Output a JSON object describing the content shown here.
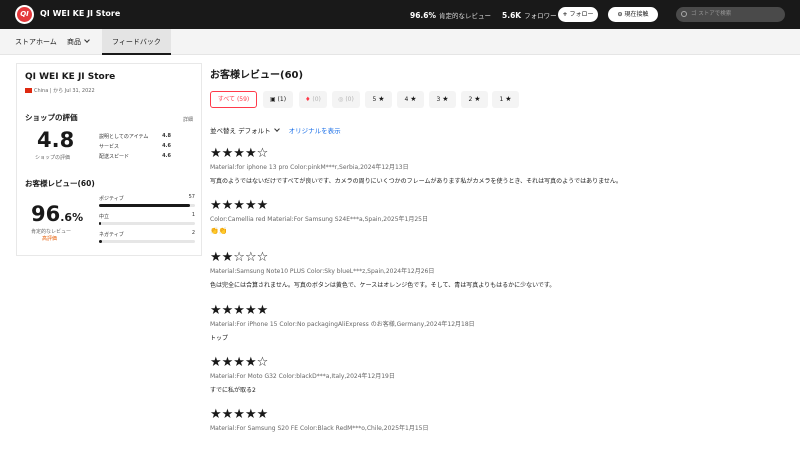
{
  "header": {
    "logo_text": "QI",
    "store_name": "QI WEI KE JI Store",
    "positive_rate": "96.6%",
    "positive_label": "肯定的なレビュー",
    "followers": "5.6K",
    "followers_label": "フォロワー",
    "follow_button": "フォロー",
    "follow_icon": "plus-icon",
    "message_button": "現在接触",
    "search_placeholder": "ゴ ストアで検索"
  },
  "nav": {
    "home": "ストアホーム",
    "products": "商品",
    "feedback": "フィードバック"
  },
  "shop": {
    "name": "QI WEI KE JI Store",
    "origin": "China | から Jul 31, 2022",
    "rating_section": "ショップの評価",
    "detail_link": "詳細",
    "score": "4.8",
    "score_label": "ショップの評価",
    "ratings": [
      {
        "label": "説明としてのアイテム",
        "value": "4.8"
      },
      {
        "label": "サービス",
        "value": "4.6"
      },
      {
        "label": "配送スピード",
        "value": "4.6"
      }
    ],
    "reviews_section": "お客様レビュー(60)",
    "positive_pct_main": "96",
    "positive_pct_frac": ".6%",
    "positive_pct_label": "肯定的なレビュー",
    "positive_badge": "高評価",
    "breakdown": [
      {
        "label": "ポジティブ",
        "count": "57",
        "fraction": 0.95
      },
      {
        "label": "中立",
        "count": "1",
        "fraction": 0.02
      },
      {
        "label": "ネガティブ",
        "count": "2",
        "fraction": 0.03
      }
    ]
  },
  "reviews_panel": {
    "title": "お客様レビュー(60)",
    "filters": [
      {
        "label": "すべて (59)"
      },
      {
        "label": "(1)"
      },
      {
        "label": "(0)"
      },
      {
        "label": "(0)"
      },
      {
        "label": "5"
      },
      {
        "label": "4"
      },
      {
        "label": "3"
      },
      {
        "label": "2"
      },
      {
        "label": "1"
      }
    ],
    "sort_label": "並べ替え",
    "sort_value": "デフォルト",
    "original_link": "オリジナルを表示"
  },
  "reviews": [
    {
      "stars": 4,
      "meta": "Material:for iphone 13 pro Color:pinkM***r,Serbia,2024年12月13日",
      "text": "写真のようではないだけですべてが良いです、カメラの周りにいくつかのフレームがあります私がカメラを使うとき、それは写真のようではありません。"
    },
    {
      "stars": 5,
      "meta": "Color:Camellia red Material:For Samsung S24E***a,Spain,2025年1月25日",
      "text": "👏👏"
    },
    {
      "stars": 2,
      "meta": "Material:Samsung Note10 PLUS Color:Sky blueL***z,Spain,2024年12月26日",
      "text": "色は完全には合算されません。写真のボタンは黄色で、ケースはオレンジ色です。そして、青は写真よりもはるかに少ないです。"
    },
    {
      "stars": 5,
      "meta": "Material:For iPhone 15 Color:No packagingAliExpress のお客様,Germany,2024年12月18日",
      "text": "トップ"
    },
    {
      "stars": 4,
      "meta": "Material:For Moto G32 Color:blackD***a,Italy,2024年12月19日",
      "text": "すでに私が取る2"
    },
    {
      "stars": 5,
      "meta": "Material:For Samsung S20 FE Color:Black RedM***o,Chile,2025年1月15日",
      "text": ""
    }
  ]
}
